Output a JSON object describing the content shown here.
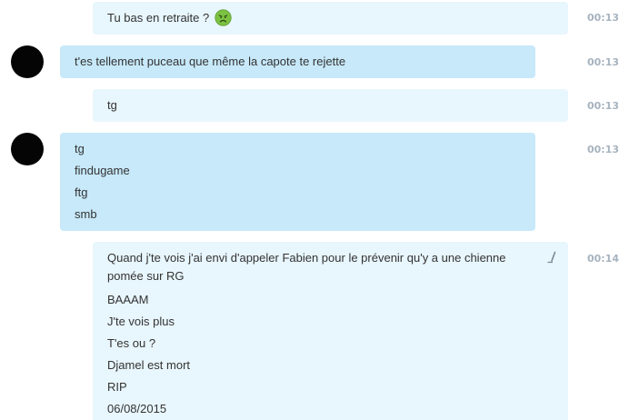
{
  "messages": [
    {
      "direction": "outgoing",
      "lines": [
        "Tu bas en retraite ?"
      ],
      "emoji": "sick-face-emoji",
      "time": "00:13"
    },
    {
      "direction": "incoming",
      "lines": [
        "t'es tellement puceau que même la capote te rejette"
      ],
      "time": "00:13"
    },
    {
      "direction": "outgoing",
      "lines": [
        "tg"
      ],
      "time": "00:13"
    },
    {
      "direction": "incoming",
      "lines": [
        "tg",
        "findugame",
        "ftg",
        "smb"
      ],
      "time": "00:13"
    },
    {
      "direction": "outgoing",
      "edited": true,
      "lines": [
        "Quand j'te vois j'ai envi d'appeler Fabien pour le prévenir qu'y a une chienne pomée sur RG",
        "BAAAM",
        "J'te vois plus",
        "T'es ou ?",
        "Djamel est mort",
        "RIP",
        "06/08/2015"
      ],
      "time": "00:14"
    }
  ],
  "colors": {
    "outgoing_bubble": "#e8f6fd",
    "incoming_bubble": "#c7e9fa",
    "timestamp": "#a7b3bf",
    "avatar": "#050505",
    "emoji": "#7cc242"
  }
}
